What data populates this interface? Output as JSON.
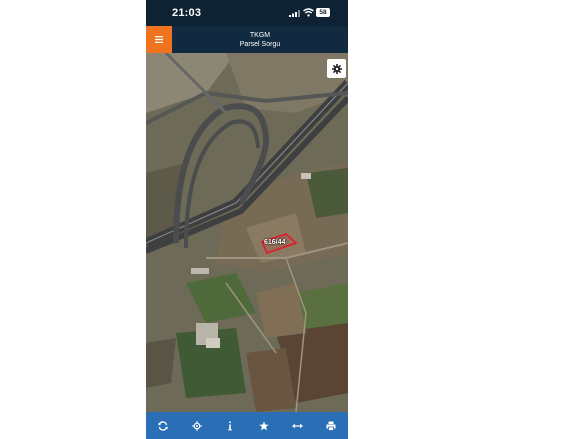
{
  "status_bar": {
    "time": "21:03",
    "battery": "58"
  },
  "app_bar": {
    "title": "TKGM",
    "subtitle": "Parsel Sorgu"
  },
  "map": {
    "parcel_label": "616/44"
  },
  "toolbar": {
    "icons": [
      "refresh-icon",
      "locate-icon",
      "info-icon",
      "star-icon",
      "measure-icon",
      "print-icon"
    ]
  },
  "colors": {
    "accent": "#f0731f",
    "toolbar": "#2a6fb5",
    "header": "#112a3f",
    "parcel_outline": "#e0202a"
  }
}
